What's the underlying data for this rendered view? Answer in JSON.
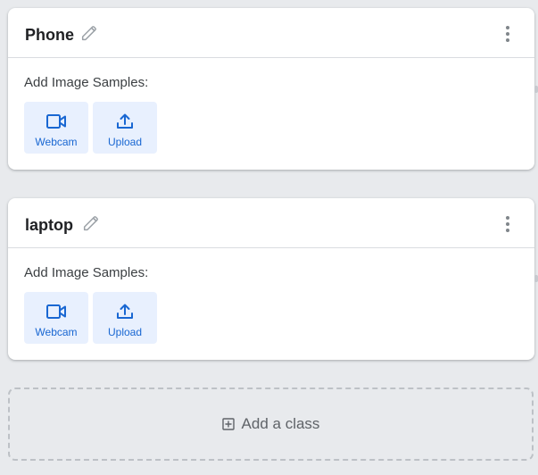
{
  "classes": [
    {
      "name": "Phone",
      "samples_label": "Add Image Samples:",
      "webcam_label": "Webcam",
      "upload_label": "Upload"
    },
    {
      "name": "laptop",
      "samples_label": "Add Image Samples:",
      "webcam_label": "Webcam",
      "upload_label": "Upload"
    }
  ],
  "add_class": {
    "label": "Add a class"
  },
  "icons": {
    "edit": "pencil-icon",
    "menu": "more-vert-icon",
    "webcam": "videocam-icon",
    "upload": "upload-icon",
    "add": "add-box-icon"
  },
  "colors": {
    "background": "#e8eaed",
    "card": "#ffffff",
    "button_bg": "#e8f0fe",
    "accent": "#1967d2",
    "text": "#202124"
  }
}
